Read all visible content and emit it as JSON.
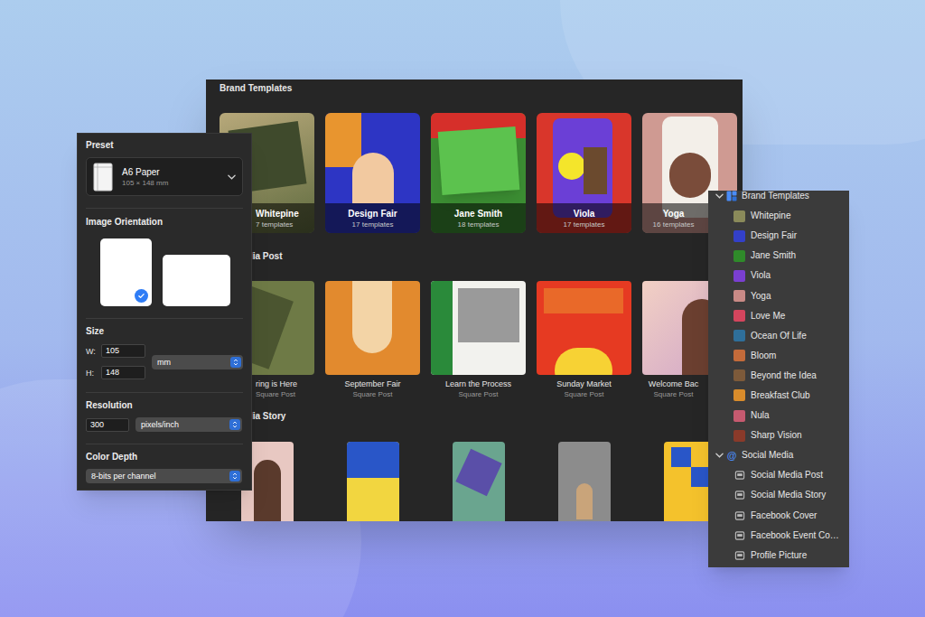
{
  "main_window": {
    "brand_templates": {
      "title": "Brand Templates",
      "cards": [
        {
          "name": "Whitepine",
          "count": "7 templates"
        },
        {
          "name": "Design Fair",
          "count": "17 templates"
        },
        {
          "name": "Jane Smith",
          "count": "18 templates"
        },
        {
          "name": "Viola",
          "count": "17 templates"
        },
        {
          "name": "Yoga",
          "count": "16 templates"
        }
      ]
    },
    "media_post": {
      "title": "edia Post",
      "cards": [
        {
          "name": "ring is Here",
          "type": "Square Post"
        },
        {
          "name": "September Fair",
          "type": "Square Post"
        },
        {
          "name": "Learn the Process",
          "type": "Square Post"
        },
        {
          "name": "Sunday Market",
          "type": "Square Post"
        },
        {
          "name": "Welcome Bac",
          "type": "Square Post"
        }
      ]
    },
    "media_story": {
      "title": "edia Story"
    }
  },
  "document_panel": {
    "preset_label": "Preset",
    "preset": {
      "name": "A6 Paper",
      "size": "105 × 148 mm"
    },
    "orientation_label": "Image Orientation",
    "orientations": [
      {
        "kind": "portrait",
        "selected": true
      },
      {
        "kind": "landscape",
        "selected": false
      }
    ],
    "size_label": "Size",
    "width": {
      "label": "W:",
      "value": "105"
    },
    "height": {
      "label": "H:",
      "value": "148"
    },
    "unit": "mm",
    "resolution_label": "Resolution",
    "resolution": "300",
    "resolution_unit": "pixels/inch",
    "color_depth_label": "Color Depth",
    "color_depth": "8-bits per channel"
  },
  "sidebar": {
    "groups": [
      {
        "label": "Brand Templates",
        "expanded": true,
        "items": [
          {
            "label": "Whitepine",
            "color": "#8a8a5a"
          },
          {
            "label": "Design Fair",
            "color": "#3340c9"
          },
          {
            "label": "Jane Smith",
            "color": "#2f8a2a"
          },
          {
            "label": "Viola",
            "color": "#7a3fd1"
          },
          {
            "label": "Yoga",
            "color": "#c98a86"
          },
          {
            "label": "Love Me",
            "color": "#d4455d"
          },
          {
            "label": "Ocean Of Life",
            "color": "#2f6f9a"
          },
          {
            "label": "Bloom",
            "color": "#c46b3a"
          },
          {
            "label": "Beyond the Idea",
            "color": "#7d5a3a"
          },
          {
            "label": "Breakfast Club",
            "color": "#d98c2b"
          },
          {
            "label": "Nula",
            "color": "#c65a6f"
          },
          {
            "label": "Sharp Vision",
            "color": "#8a3a2a"
          }
        ]
      },
      {
        "label": "Social Media",
        "icon": "@",
        "expanded": true,
        "items": [
          {
            "label": "Social Media Post"
          },
          {
            "label": "Social Media Story"
          },
          {
            "label": "Facebook Cover"
          },
          {
            "label": "Facebook Event Co…"
          },
          {
            "label": "Profile Picture"
          }
        ]
      }
    ]
  }
}
